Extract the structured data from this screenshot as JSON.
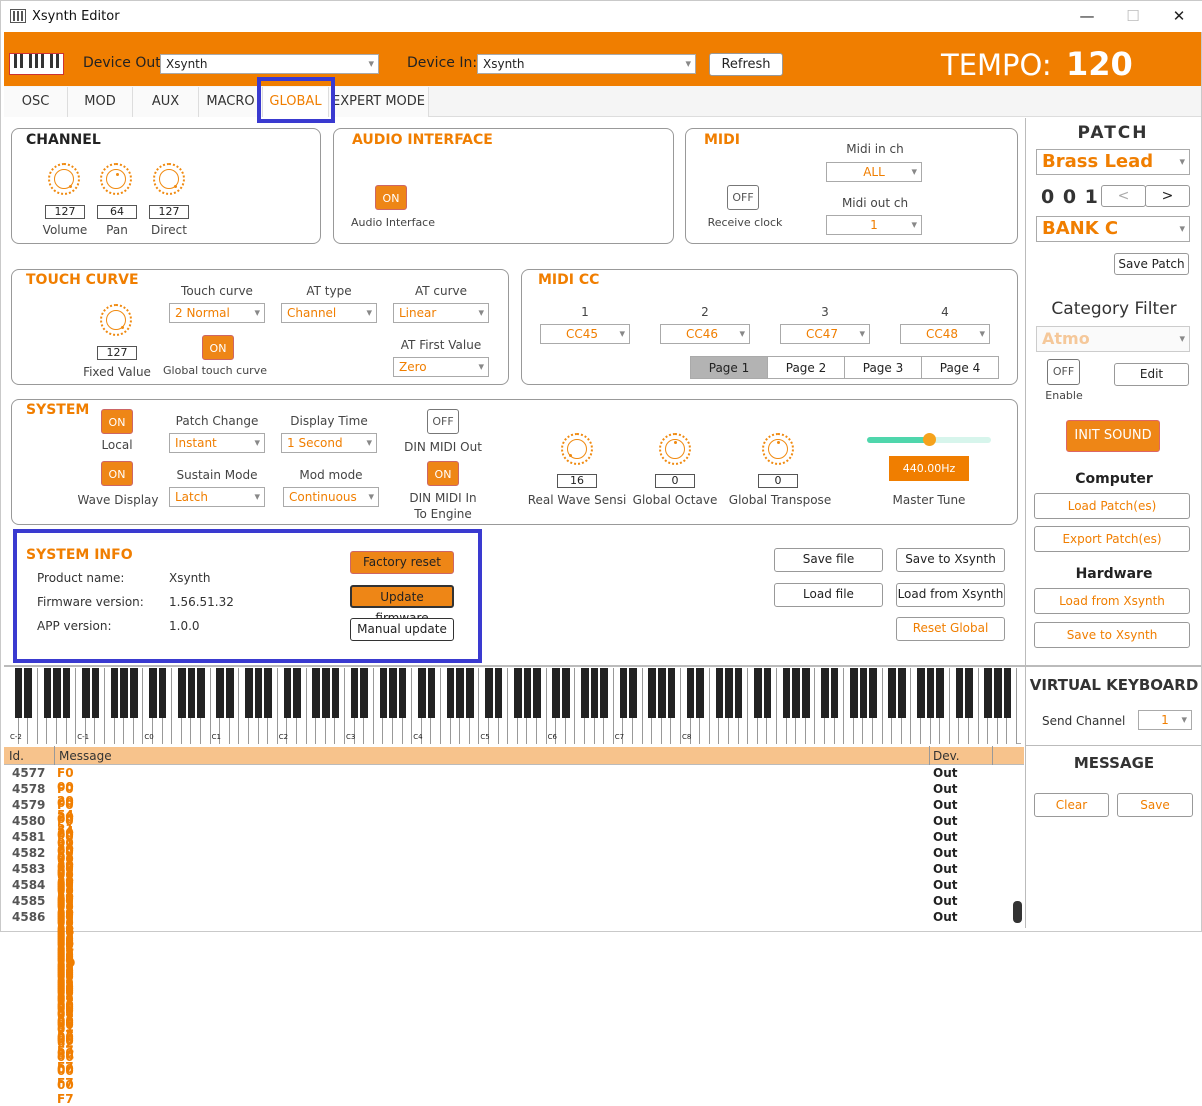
{
  "window": {
    "title": "Xsynth Editor",
    "min": "—",
    "max": "☐",
    "close": "✕"
  },
  "header": {
    "device_out_label": "Device Out:",
    "device_out_value": "Xsynth",
    "device_in_label": "Device In:",
    "device_in_value": "Xsynth",
    "refresh": "Refresh",
    "tempo_label": "TEMPO:",
    "tempo_value": "120"
  },
  "tabs": [
    "OSC",
    "MOD",
    "AUX",
    "MACRO",
    "GLOBAL",
    "EXPERT MODE"
  ],
  "channel": {
    "title": "CHANNEL",
    "knobs": [
      {
        "label": "Volume",
        "value": "127"
      },
      {
        "label": "Pan",
        "value": "64"
      },
      {
        "label": "Direct",
        "value": "127"
      }
    ]
  },
  "audio": {
    "title": "AUDIO  INTERFACE",
    "toggle": "ON",
    "label": "Audio Interface"
  },
  "midi": {
    "title": "MIDI",
    "receive_toggle": "OFF",
    "receive_label": "Receive clock",
    "in_label": "Midi in ch",
    "in_value": "ALL",
    "out_label": "Midi out ch",
    "out_value": "1"
  },
  "touch": {
    "title": "TOUCH  CURVE",
    "fixed_value": "127",
    "fixed_label": "Fixed Value",
    "curve_label": "Touch curve",
    "curve_value": "2 Normal",
    "at_type_label": "AT  type",
    "at_type_value": "Channel",
    "at_curve_label": "AT curve",
    "at_curve_value": "Linear",
    "global_toggle": "ON",
    "global_label": "Global touch curve",
    "at_first_label": "AT First Value",
    "at_first_value": "Zero"
  },
  "midicc": {
    "title": "MIDI  CC",
    "cols": [
      {
        "n": "1",
        "v": "CC45"
      },
      {
        "n": "2",
        "v": "CC46"
      },
      {
        "n": "3",
        "v": "CC47"
      },
      {
        "n": "4",
        "v": "CC48"
      }
    ],
    "pages": [
      "Page  1",
      "Page  2",
      "Page  3",
      "Page  4"
    ]
  },
  "system": {
    "title": "SYSTEM",
    "local_toggle": "ON",
    "local_label": "Local",
    "wave_toggle": "ON",
    "wave_label": "Wave Display",
    "patch_change_label": "Patch Change",
    "patch_change_value": "Instant",
    "display_time_label": "Display Time",
    "display_time_value": "1 Second",
    "sustain_label": "Sustain Mode",
    "sustain_value": "Latch",
    "mod_label": "Mod mode",
    "mod_value": "Continuous",
    "din_out_toggle": "OFF",
    "din_out_label": "DIN MIDI Out",
    "din_in_toggle": "ON",
    "din_in_label1": "DIN MIDI In",
    "din_in_label2": "To Engine",
    "rws_value": "16",
    "rws_label": "Real Wave Sensi",
    "octave_value": "0",
    "octave_label": "Global Octave",
    "transpose_value": "0",
    "transpose_label": "Global Transpose",
    "tune_value": "440.00Hz",
    "tune_label": "Master Tune",
    "tune_level": 0.5
  },
  "sysinfo": {
    "title": "SYSTEM  INFO",
    "product_label": "Product name:",
    "product_value": "Xsynth",
    "fw_label": "Firmware version:",
    "fw_value": "1.56.51.32",
    "app_label": "APP version:",
    "app_value": "1.0.0",
    "factory_reset": "Factory reset",
    "update_fw": "Update firmware",
    "manual_update": "Manual update"
  },
  "file_buttons": {
    "save_file": "Save file",
    "save_to": "Save to Xsynth",
    "load_file": "Load file",
    "load_from": "Load from Xsynth",
    "reset_global": "Reset Global"
  },
  "patch": {
    "title": "PATCH",
    "name": "Brass Lead",
    "number": "0 0 1",
    "prev": "<",
    "next": ">",
    "bank": "BANK C",
    "save": "Save Patch",
    "cat_title": "Category Filter",
    "cat_value": "Atmo",
    "enable_toggle": "OFF",
    "enable_label": "Enable",
    "edit": "Edit",
    "init": "INIT  SOUND",
    "computer": "Computer",
    "load_patch": "Load Patch(es)",
    "export_patch": "Export Patch(es)",
    "hardware": "Hardware",
    "load_from": "Load from Xsynth",
    "save_to": "Save to Xsynth"
  },
  "vk": {
    "title": "VIRTUAL KEYBOARD",
    "send_label": "Send Channel",
    "send_value": "1",
    "octaves": [
      "C-2",
      "C-1",
      "C0",
      "C1",
      "C2",
      "C3",
      "C4",
      "C5",
      "C6",
      "C7",
      "C8"
    ]
  },
  "messages": {
    "col_id": "Id.",
    "col_msg": "Message",
    "col_dev": "Dev.",
    "title": "MESSAGE",
    "clear": "Clear",
    "save": "Save",
    "rows": [
      {
        "id": "4577",
        "msg": "F0 00 20 54 21 00 02 09 01 27 00 7F 00 F7",
        "dev": "Out"
      },
      {
        "id": "4578",
        "msg": "F0 00 20 54 21 00 02 09 01 28 00 00 00 F7",
        "dev": "Out"
      },
      {
        "id": "4579",
        "msg": "F0 00 20 54 21 00 02 09 01 2B 00 00 00 F7",
        "dev": "Out"
      },
      {
        "id": "4580",
        "msg": "F0 00 20 54 21 00 02 09 01 2C 00 00 00 F7",
        "dev": "Out"
      },
      {
        "id": "4581",
        "msg": "F0 00 20 54 21 00 02 09 01 2D 00 00 00 F7",
        "dev": "Out"
      },
      {
        "id": "4582",
        "msg": "F0 00 20 54 21 00 02 09 01 2E 00 00 00 F7",
        "dev": "Out"
      },
      {
        "id": "4583",
        "msg": "F0 00 20 54 21 00 02 09 01 2F 00 00 00 F7",
        "dev": "Out"
      },
      {
        "id": "4584",
        "msg": "F0 00 20 54 21 00 02 09 01 30 00 00 00 F7",
        "dev": "Out"
      },
      {
        "id": "4585",
        "msg": "F0 00 20 54 21 00 02 09 01 31 00 3C 00 F7",
        "dev": "Out"
      },
      {
        "id": "4586",
        "msg": "F0 00 20 54 21 00 02 09 01 62 00 00 00 F7",
        "dev": "Out"
      }
    ]
  },
  "colors": {
    "accent": "#f07e00",
    "highlight": "#3a3ad0"
  }
}
